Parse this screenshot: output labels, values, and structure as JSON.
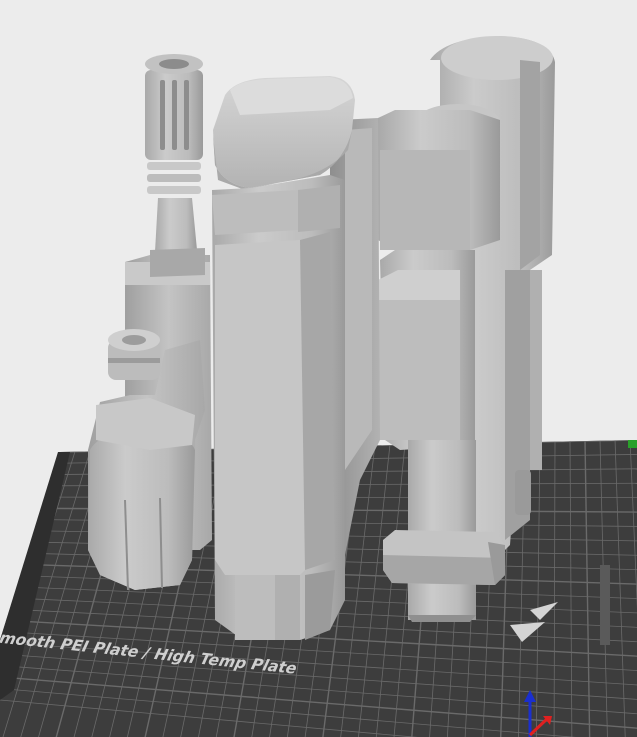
{
  "plate": {
    "label": "Bambu Smooth PEI Plate / High Temp Plate",
    "label_color": "#cfcfcf"
  },
  "view": {
    "background_color": "#ececec",
    "grid_color": "#3d3d3d",
    "grid_line_color": "#6a6a6a",
    "model_color": "#b9b9b9",
    "axis_x_color": "#e02020",
    "axis_y_color": "#2aa02a",
    "axis_z_color": "#1a2fd0"
  },
  "icons": {
    "plate_logo": "bambu-logo-icon",
    "orientation": "orientation-gizmo-icon"
  }
}
